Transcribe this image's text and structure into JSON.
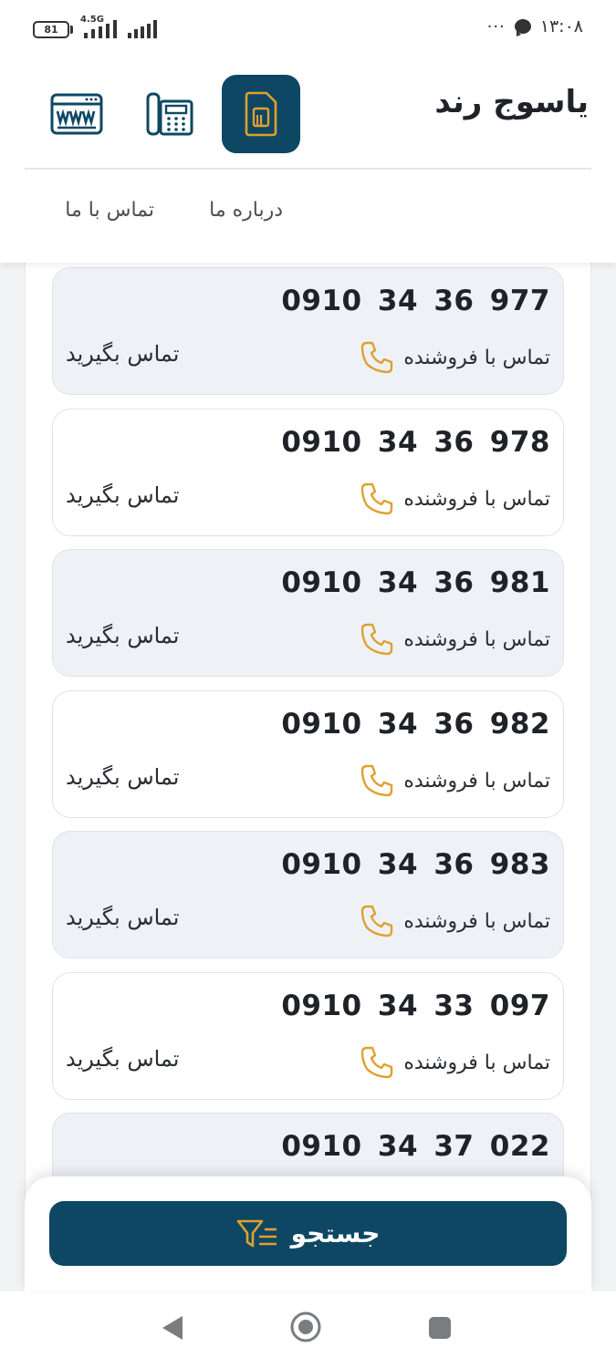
{
  "status_bar": {
    "battery": "81",
    "network": "4.5G",
    "time": "۱۳:۰۸",
    "dots": "···"
  },
  "header": {
    "brand": "یاسوج رند",
    "icons": [
      "sim-card-icon",
      "desk-phone-icon",
      "www-icon"
    ],
    "nav": {
      "about": "درباره ما",
      "contact": "تماس با ما"
    }
  },
  "listings": [
    {
      "number": "0910 34 36 977",
      "seller_label": "تماس با فروشنده",
      "call_label": "تماس بگیرید"
    },
    {
      "number": "0910 34 36 978",
      "seller_label": "تماس با فروشنده",
      "call_label": "تماس بگیرید"
    },
    {
      "number": "0910 34 36 981",
      "seller_label": "تماس با فروشنده",
      "call_label": "تماس بگیرید"
    },
    {
      "number": "0910 34 36 982",
      "seller_label": "تماس با فروشنده",
      "call_label": "تماس بگیرید"
    },
    {
      "number": "0910 34 36 983",
      "seller_label": "تماس با فروشنده",
      "call_label": "تماس بگیرید"
    },
    {
      "number": "0910 34 33 097",
      "seller_label": "تماس با فروشنده",
      "call_label": "تماس بگیرید"
    },
    {
      "number": "0910 34 37 022",
      "seller_label": "",
      "call_label": ""
    }
  ],
  "search": {
    "label": "جستجو",
    "icon": "filter-icon"
  },
  "colors": {
    "primary": "#0d4763",
    "accent": "#e0a030",
    "card_alt": "#eef2f7"
  }
}
